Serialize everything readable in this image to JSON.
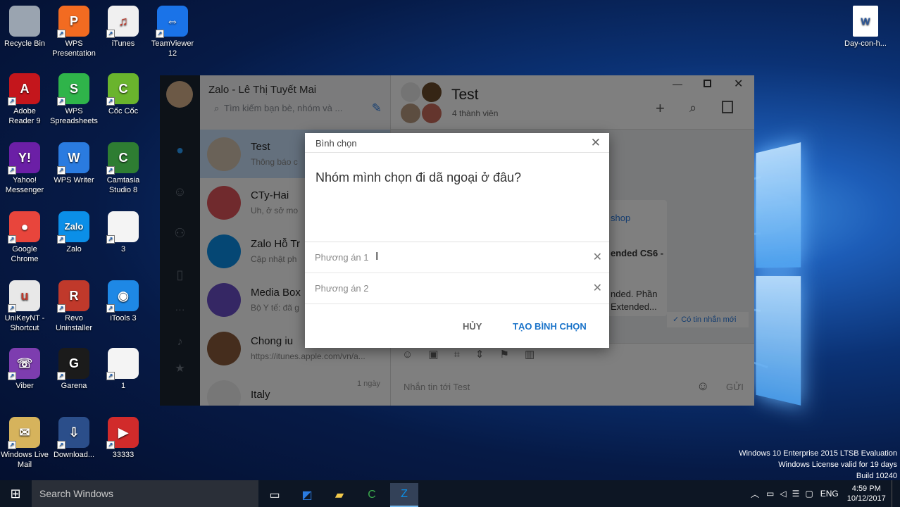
{
  "desktop": {
    "icons": [
      {
        "label": "Recycle Bin",
        "icon": "recycle-bin-icon",
        "color": "#9aa4b0"
      },
      {
        "label": "WPS Presentation",
        "icon": "wps-presentation-icon",
        "color": "#f26b21",
        "glyph": "P"
      },
      {
        "label": "iTunes",
        "icon": "itunes-icon",
        "color": "#f0f0f0",
        "glyph": "♫"
      },
      {
        "label": "TeamViewer 12",
        "icon": "teamviewer-icon",
        "color": "#1a73e8",
        "glyph": "⇔"
      },
      {
        "label": "Adobe Reader 9",
        "icon": "adobe-reader-icon",
        "color": "#c4161c",
        "glyph": "A"
      },
      {
        "label": "WPS Spreadsheets",
        "icon": "wps-spreadsheets-icon",
        "color": "#2fb44a",
        "glyph": "S"
      },
      {
        "label": "Cốc Cốc",
        "icon": "coccoc-icon",
        "color": "#6ab42d",
        "glyph": "C"
      },
      {
        "label": "Yahoo! Messenger",
        "icon": "yahoo-messenger-icon",
        "color": "#6b1fa6",
        "glyph": "Y!"
      },
      {
        "label": "WPS Writer",
        "icon": "wps-writer-icon",
        "color": "#2a7be0",
        "glyph": "W"
      },
      {
        "label": "Camtasia Studio 8",
        "icon": "camtasia-icon",
        "color": "#2e7d32",
        "glyph": "C"
      },
      {
        "label": "Google Chrome",
        "icon": "chrome-icon",
        "color": "#e8453c",
        "glyph": "●"
      },
      {
        "label": "Zalo",
        "icon": "zalo-icon",
        "color": "#0b8fe8",
        "glyph": "Zalo"
      },
      {
        "label": "3",
        "icon": "file-icon",
        "color": "#f4f4f4",
        "glyph": ""
      },
      {
        "label": "UniKeyNT - Shortcut",
        "icon": "unikey-icon",
        "color": "#e8e8e8",
        "glyph": "u"
      },
      {
        "label": "Revo Uninstaller",
        "icon": "revo-uninstaller-icon",
        "color": "#c0392b",
        "glyph": "R"
      },
      {
        "label": "iTools 3",
        "icon": "itools-icon",
        "color": "#1e88e5",
        "glyph": "◉"
      },
      {
        "label": "Viber",
        "icon": "viber-icon",
        "color": "#7d3daf",
        "glyph": "☏"
      },
      {
        "label": "Garena",
        "icon": "garena-icon",
        "color": "#1b1b1b",
        "glyph": "G"
      },
      {
        "label": "1",
        "icon": "file-icon",
        "color": "#f4f4f4",
        "glyph": ""
      },
      {
        "label": "Windows Live Mail",
        "icon": "live-mail-icon",
        "color": "#d6b35c",
        "glyph": "✉"
      },
      {
        "label": "Download...",
        "icon": "download-icon",
        "color": "#2b4e8a",
        "glyph": "⇩"
      },
      {
        "label": "33333",
        "icon": "video-icon",
        "color": "#d12b2b",
        "glyph": "▶"
      }
    ],
    "right_icon": {
      "label": "Day-con-h...",
      "icon": "word-document-icon"
    }
  },
  "zalo": {
    "title": "Zalo - Lê Thị Tuyết Mai",
    "search_placeholder": "Tìm kiếm bạn bè, nhóm và ...",
    "conversations": [
      {
        "name": "Test",
        "preview": "Thông báo c"
      },
      {
        "name": "CTy-Hai",
        "preview": "Uh, ở sở mo"
      },
      {
        "name": "Zalo Hỗ Tr",
        "preview": "Cập nhật ph"
      },
      {
        "name": "Media Box",
        "preview": "Bộ Y tế: đã g"
      },
      {
        "name": "Chong iu",
        "preview": "https://itunes.apple.com/vn/a..."
      },
      {
        "name": "Italy",
        "preview": "",
        "time": "1 ngày"
      }
    ],
    "chat": {
      "title": "Test",
      "members": "4 thành viên",
      "link_text": "shop",
      "snippet1": "ended CS6 -",
      "snippet2": "nded. Phần",
      "snippet3": "Extended...",
      "new_msg": "Có tin nhắn mới",
      "input_placeholder": "Nhắn tin tới Test",
      "send": "GỬI"
    }
  },
  "dialog": {
    "title": "Bình chọn",
    "question": "Nhóm mình chọn đi dã ngoại ở đâu?",
    "options": [
      "Phương án 1",
      "Phương án 2"
    ],
    "cancel": "HỦY",
    "create": "TẠO BÌNH CHỌN",
    "accent": "#1a73c9"
  },
  "taskbar": {
    "search": "Search Windows",
    "lang": "ENG",
    "time": "4:59 PM",
    "date": "10/12/2017"
  },
  "watermark": {
    "line1": "Windows 10 Enterprise 2015 LTSB Evaluation",
    "line2": "Windows License valid for 19 days",
    "line3": "Build 10240"
  }
}
